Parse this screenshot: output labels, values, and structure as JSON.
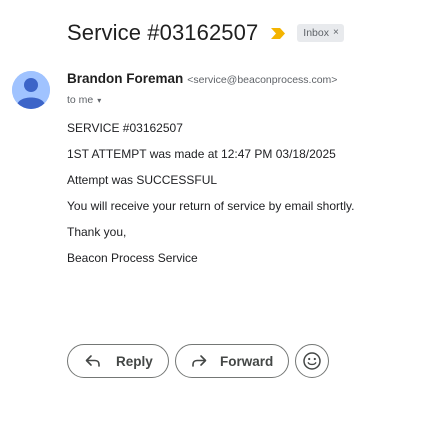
{
  "header": {
    "subject": "Service #03162507",
    "label": "Inbox",
    "label_remove": "×",
    "important_color": "#f4b400"
  },
  "sender": {
    "name": "Brandon Foreman",
    "email": "<service@beaconprocess.com>",
    "recipient": "to me",
    "recipient_caret": "▾",
    "avatar_color": "#a0c3ff",
    "avatar_icon": "person-icon"
  },
  "body": {
    "lines": [
      "SERVICE #03162507",
      "1ST ATTEMPT was made at 12:47 PM 03/18/2025",
      "Attempt was SUCCESSFUL",
      "You will receive your return of service by email shortly.",
      "Thank you,",
      "Beacon Process Service"
    ]
  },
  "actions": {
    "reply_label": "Reply",
    "forward_label": "Forward",
    "reply_icon": "reply-icon",
    "forward_icon": "forward-icon",
    "emoji_icon": "emoji-reaction-icon"
  }
}
